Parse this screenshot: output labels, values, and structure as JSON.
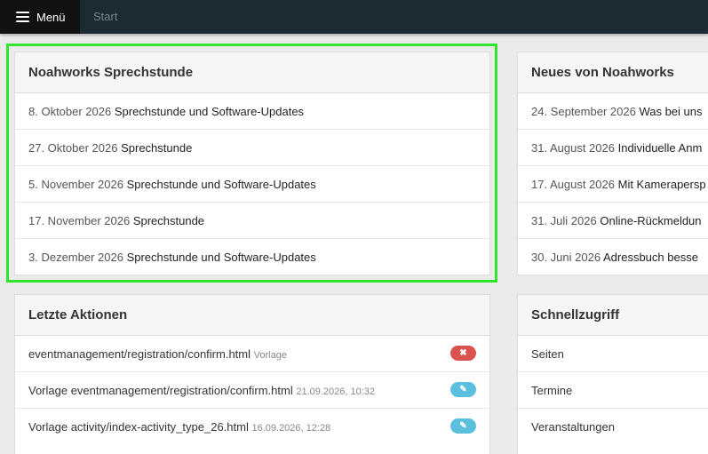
{
  "topbar": {
    "menu_label": "Menü",
    "start_label": "Start"
  },
  "sprechstunde": {
    "title": "Noahworks Sprechstunde",
    "items": [
      {
        "date": "8. Oktober 2026",
        "title": "Sprechstunde und Software-Updates"
      },
      {
        "date": "27. Oktober 2026",
        "title": "Sprechstunde"
      },
      {
        "date": "5. November 2026",
        "title": "Sprechstunde und Software-Updates"
      },
      {
        "date": "17. November 2026",
        "title": "Sprechstunde"
      },
      {
        "date": "3. Dezember 2026",
        "title": "Sprechstunde und Software-Updates"
      }
    ]
  },
  "neues": {
    "title": "Neues von Noahworks",
    "items": [
      {
        "date": "24. September 2026",
        "title": "Was bei uns"
      },
      {
        "date": "31. August 2026",
        "title": "Individuelle Anm"
      },
      {
        "date": "17. August 2026",
        "title": "Mit Kamerapersp"
      },
      {
        "date": "31. Juli 2026",
        "title": "Online-Rückmeldun"
      },
      {
        "date": "30. Juni 2026",
        "title": "Adressbuch besse"
      }
    ]
  },
  "aktionen": {
    "title": "Letzte Aktionen",
    "items": [
      {
        "text": "eventmanagement/registration/confirm.html",
        "meta": "Vorlage",
        "icon": "delete-icon"
      },
      {
        "text": "Vorlage eventmanagement/registration/confirm.html",
        "meta": "21.09.2026, 10:32",
        "icon": "edit-icon"
      },
      {
        "text": "Vorlage activity/index-activity_type_26.html",
        "meta": "16.09.2026, 12:28",
        "icon": "edit-icon"
      }
    ]
  },
  "schnellzugriff": {
    "title": "Schnellzugriff",
    "items": [
      "Seiten",
      "Termine",
      "Veranstaltungen"
    ]
  },
  "colors": {
    "topbar": "#1c2a31",
    "highlight": "#2ee62e",
    "badge_red": "#d9534f",
    "badge_blue": "#5bc0de"
  }
}
